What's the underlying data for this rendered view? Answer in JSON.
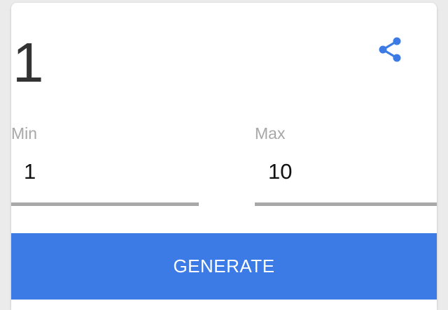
{
  "result": {
    "value": "1"
  },
  "share": {
    "icon": "share-icon",
    "color": "#3c7be6"
  },
  "min": {
    "label": "Min",
    "value": "1"
  },
  "max": {
    "label": "Max",
    "value": "10"
  },
  "generate": {
    "label": "GENERATE",
    "color": "#3c7be6"
  }
}
